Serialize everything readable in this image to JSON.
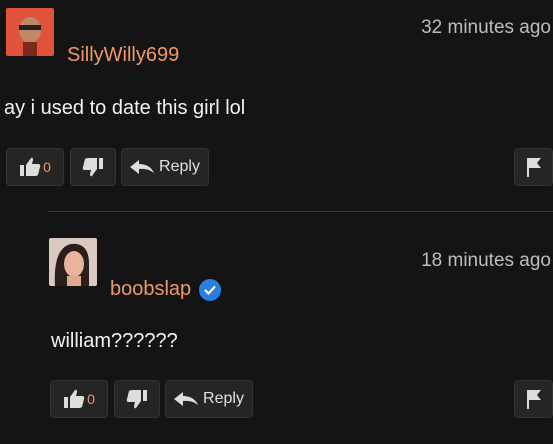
{
  "comments": [
    {
      "username": "SillyWilly699",
      "time": "32 minutes ago",
      "text": "ay i used to date this girl lol",
      "likes": "0",
      "reply_label": "Reply",
      "avatar_icon": "user-photo-avatar",
      "verified": false
    },
    {
      "username": "boobslap",
      "time": "18 minutes ago",
      "text": "william??????",
      "likes": "0",
      "reply_label": "Reply",
      "avatar_icon": "user-photo-avatar",
      "verified": true
    }
  ],
  "colors": {
    "background": "#141414",
    "username": "#f0986a",
    "button_bg": "#252525",
    "verified": "#2a7de1"
  }
}
